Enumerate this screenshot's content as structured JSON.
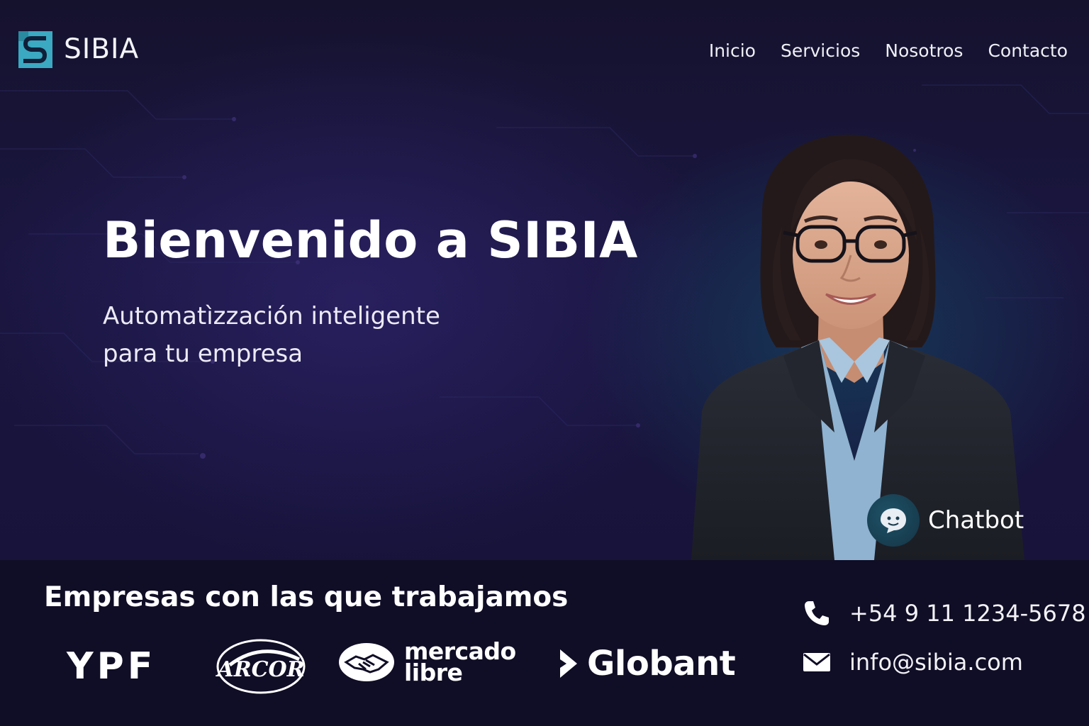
{
  "header": {
    "brand_name": "SIBIA",
    "nav": [
      "Inicio",
      "Servicios",
      "Nosotros",
      "Contacto"
    ]
  },
  "hero": {
    "title": "Bienvenido a SIBIA",
    "subtitle_line1": "Automatìzzación inteligente",
    "subtitle_line2": "para tu empresa"
  },
  "chatbot": {
    "label": "Chatbot",
    "icon": "chat-face-icon"
  },
  "clients": {
    "title": "Empresas con las que trabajamos",
    "logos": {
      "ypf": "YPF",
      "arcor": "ARCOR",
      "mercadolibre_line1": "mercado",
      "mercadolibre_line2": "libre",
      "globant": "Globant"
    }
  },
  "contact": {
    "phone": "+54 9 11 1234-5678",
    "email": "info@sibia.com",
    "phone_icon": "phone-icon",
    "email_icon": "envelope-icon"
  },
  "colors": {
    "background": "#0f0d24",
    "hero_mid": "#1a1640",
    "accent_teal": "#3aa9c1",
    "text": "#ffffff"
  }
}
